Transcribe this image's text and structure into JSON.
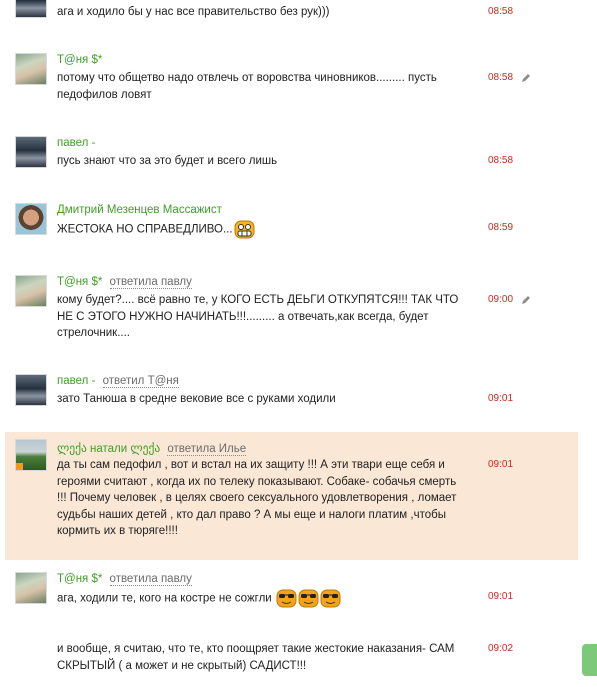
{
  "messages": [
    {
      "author": "",
      "reply_to": "",
      "text": "ага и ходило бы у нас все правительство без рук)))",
      "time": "08:58"
    },
    {
      "author": "T@ня $*",
      "reply_to": "",
      "text": "потому что  общетво надо отвлечь от воровства чиновников.........   пусть педофилов ловят",
      "time": "08:58"
    },
    {
      "author": "павел -",
      "reply_to": "",
      "text": "пусь знают что за это будет и всего лишь",
      "time": "08:58"
    },
    {
      "author": "Дмитрий Мезенцев Массажист",
      "reply_to": "",
      "text": "ЖЕСТОКА НО СПРАВЕДЛИВО...",
      "time": "08:59"
    },
    {
      "author": "T@ня $*",
      "reply_to": "ответила павлу",
      "text": "кому будет?.... всё равно те, у  КОГО ЕСТЬ ДЕЬГИ ОТКУПЯТСЯ!!!  ТАК ЧТО НЕ С ЭТОГО НУЖНО НАЧИНАТЬ!!!......... а   отвечать,как всегда, будет стрелочник....",
      "time": "09:00"
    },
    {
      "author": "павел -",
      "reply_to": "ответил T@ня",
      "text": "зато Танюша в средне вековие  все с руками ходили",
      "time": "09:01"
    },
    {
      "author": "ლექა натали ლექა",
      "reply_to": "ответила Илье",
      "text": "да ты сам педофил , вот и встал на их защиту !!! А эти твари еще себя и героями считают , когда их по телеку показывают. Собаке- собачья смерть !!! Почему человек , в целях своего сексуального удовлетворения , ломает судьбы наших детей , кто дал право ? А мы еще и налоги платим ,чтобы кормить их в тюряге!!!!",
      "time": "09:01"
    },
    {
      "author": "T@ня $*",
      "reply_to": "ответила павлу",
      "text": "ага, ходили те, кого на костре не сожгли",
      "time": "09:01"
    },
    {
      "author": "",
      "reply_to": "",
      "text": "и вообще, я считаю, что те, кто поощряет такие жестокие наказания- САМ СКРЫТЫЙ ( а может и не скрытый) САДИСТ!!!",
      "time": "09:02"
    }
  ],
  "colors": {
    "author": "#3f9e25",
    "time": "#d0281e",
    "highlight": "#fbe7d5",
    "scroll_tab": "#7cc97a"
  },
  "icons": {
    "edit": "pencil-icon",
    "smiley_grin": "grinning-smiley-icon",
    "smiley_cool": "sunglasses-smiley-icon"
  }
}
